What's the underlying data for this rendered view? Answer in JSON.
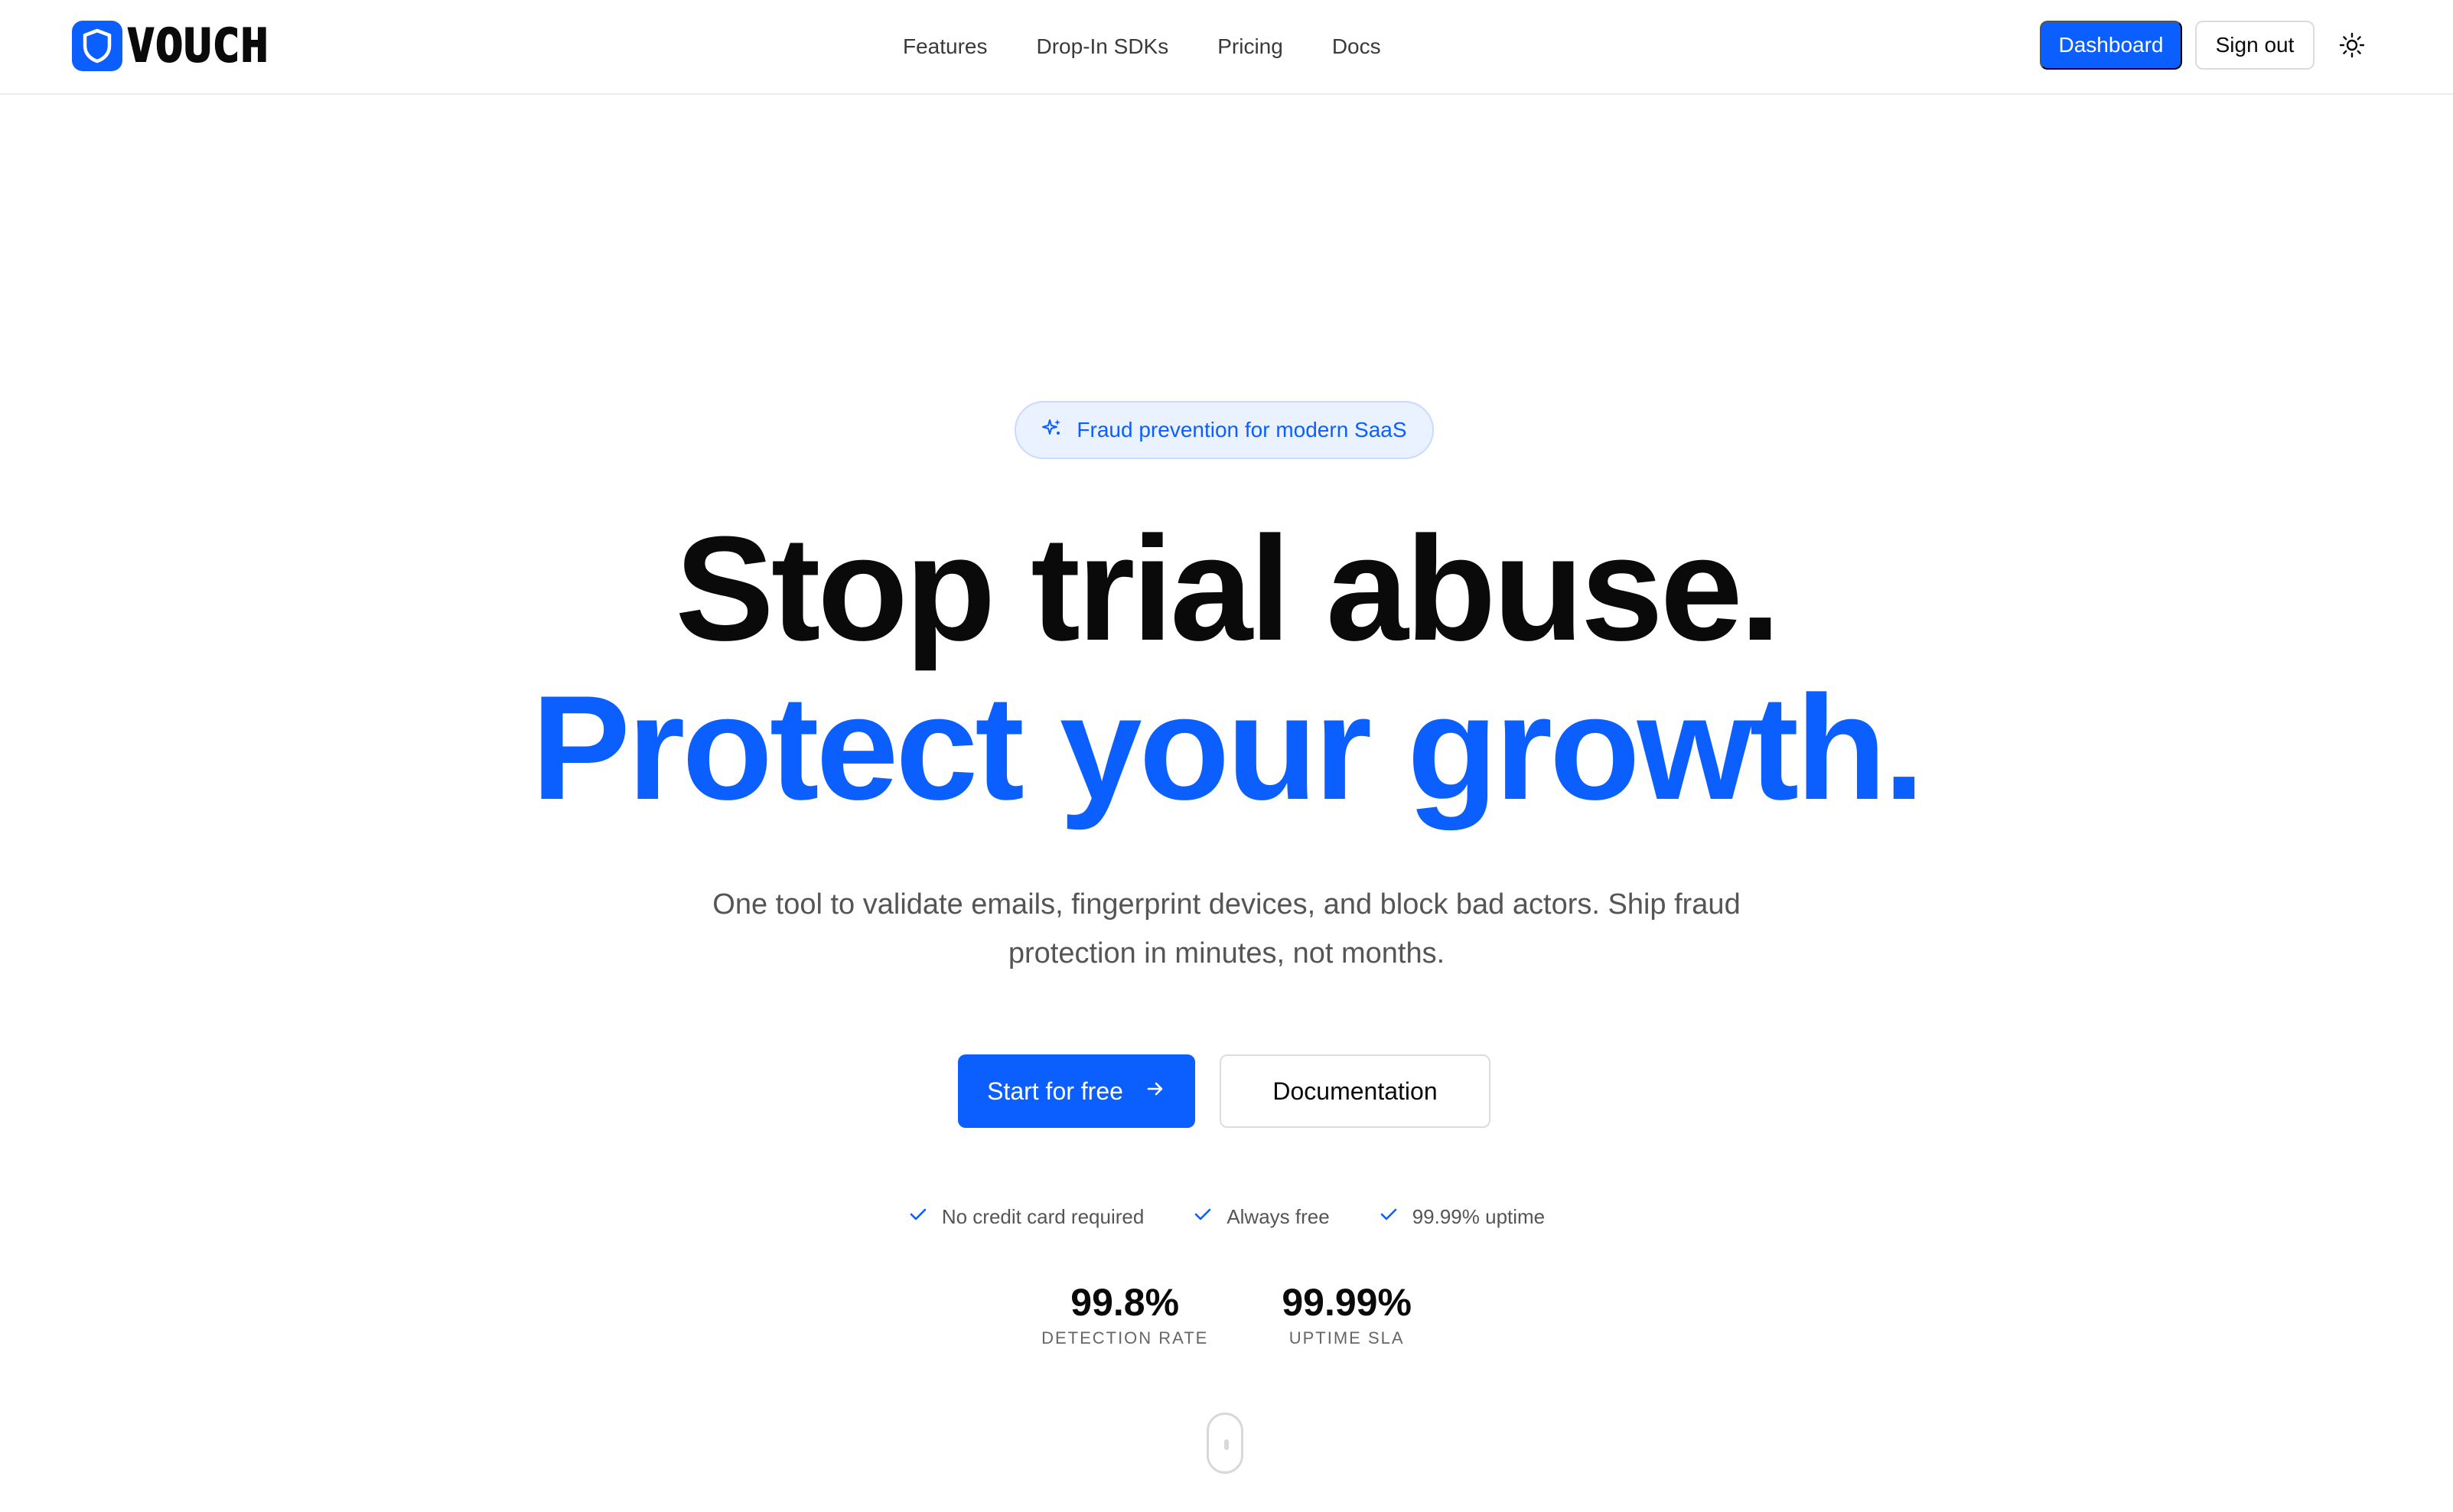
{
  "brand": {
    "name": "VOUCH",
    "accent_color": "#0b5fff",
    "logo_icon": "shield-icon"
  },
  "nav": {
    "items": [
      {
        "label": "Features"
      },
      {
        "label": "Drop-In SDKs"
      },
      {
        "label": "Pricing"
      },
      {
        "label": "Docs"
      }
    ]
  },
  "header_actions": {
    "dashboard_label": "Dashboard",
    "signout_label": "Sign out",
    "theme_icon": "sun-icon"
  },
  "hero": {
    "badge_icon": "sparkles-icon",
    "badge_text": "Fraud prevention for modern SaaS",
    "headline_line1": "Stop trial abuse.",
    "headline_line2": "Protect your growth.",
    "subtext": "One tool to validate emails, fingerprint devices, and block bad actors. Ship fraud protection in minutes, not months.",
    "primary_cta": "Start for free",
    "secondary_cta": "Documentation",
    "checks": [
      {
        "label": "No credit card required"
      },
      {
        "label": "Always free"
      },
      {
        "label": "99.99% uptime"
      }
    ],
    "stats": [
      {
        "value": "99.8%",
        "label": "DETECTION RATE"
      },
      {
        "value": "99.99%",
        "label": "UPTIME SLA"
      }
    ]
  }
}
